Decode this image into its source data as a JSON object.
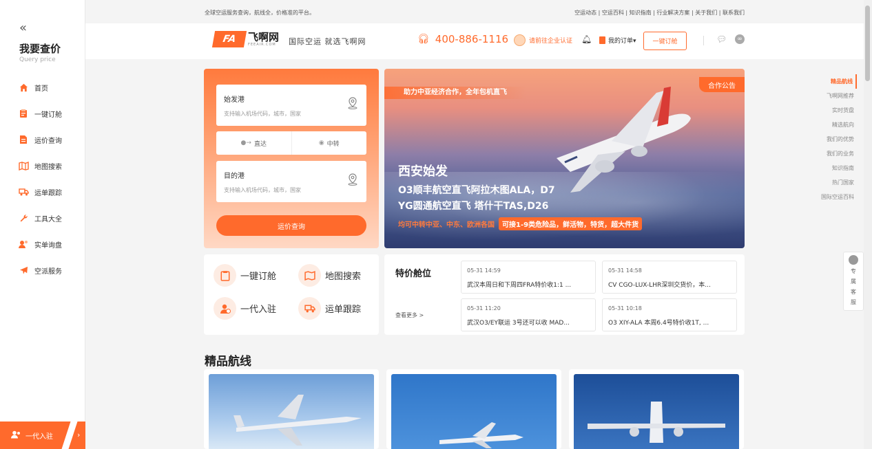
{
  "sidebar": {
    "title": "我要查价",
    "subtitle": "Query price",
    "items": [
      {
        "label": "首页",
        "icon": "home-icon"
      },
      {
        "label": "一键订舱",
        "icon": "clipboard-icon"
      },
      {
        "label": "运价查询",
        "icon": "document-icon"
      },
      {
        "label": "地图搜索",
        "icon": "map-icon"
      },
      {
        "label": "运单跟踪",
        "icon": "truck-icon"
      },
      {
        "label": "工具大全",
        "icon": "wrench-icon"
      },
      {
        "label": "实单询盘",
        "icon": "user-group-icon"
      },
      {
        "label": "空派服务",
        "icon": "airplane-icon"
      }
    ],
    "bottom_label": "一代入驻"
  },
  "topstrip": {
    "left": "全球空运服务查询，航线全，价格准的平台。",
    "right": "空运动态 | 空运百科 | 知识指南 | 行业解决方案 | 关于我们 | 联系我们"
  },
  "header": {
    "logo_mark": "FA",
    "logo_cn": "飞啊网",
    "logo_en": "FEEAIR.COM",
    "slogan": "国际空运  就选飞啊网",
    "phone": "400-886-1116",
    "certify": "请前往企业认证",
    "my_orders": "我的订单▾",
    "quick_book": "一键订舱"
  },
  "search": {
    "origin_label": "始发港",
    "origin_placeholder": "支持输入机场代码，城市，国家",
    "direct": "直达",
    "transfer": "中转",
    "dest_label": "目的港",
    "dest_placeholder": "支持输入机场代码，城市，国家",
    "query_button": "运价查询"
  },
  "banner": {
    "tag": "助力中亚经济合作，全年包机直飞",
    "corner": "合作公告",
    "heading": "西安始发",
    "line1": "O3顺丰航空直飞阿拉木图ALA，D7",
    "line2": "YG圆通航空直飞 塔什干TAS,D26",
    "line3a": "均可中转中亚、中东、欧洲各国",
    "line3b": "可接1-9类危险品，鲜活物，特货，超大件货"
  },
  "quick_actions": [
    {
      "label": "一键订舱",
      "icon": "clipboard-icon"
    },
    {
      "label": "地图搜索",
      "icon": "map-icon"
    },
    {
      "label": "一代入驻",
      "icon": "user-add-icon"
    },
    {
      "label": "运单跟踪",
      "icon": "truck-icon"
    }
  ],
  "specials": {
    "title": "特价舱位",
    "more": "查看更多 >",
    "items": [
      {
        "time": "05-31 14:59",
        "text": "武汉本周日和下周四FRA特价收1:1 ..."
      },
      {
        "time": "05-31 14:58",
        "text": "CV CGO-LUX-LHR深圳交货价，本..."
      },
      {
        "time": "05-31 11:20",
        "text": "武汉O3/EY联运 3号还可以收 MAD..."
      },
      {
        "time": "05-31 10:18",
        "text": "O3 XIY-ALA 本周6.4号特价收1T, ..."
      }
    ]
  },
  "section": {
    "title": "精品航线"
  },
  "right_nav": [
    "精品航线",
    "飞啊网推荐",
    "实时货盘",
    "精选航向",
    "我们的优势",
    "我们的业务",
    "知识指南",
    "热门国家",
    "国际空运百科"
  ],
  "service": {
    "chars": [
      "专",
      "属",
      "客",
      "服"
    ]
  },
  "colors": {
    "accent": "#ff6a2c",
    "background": "#f4f4f4"
  }
}
